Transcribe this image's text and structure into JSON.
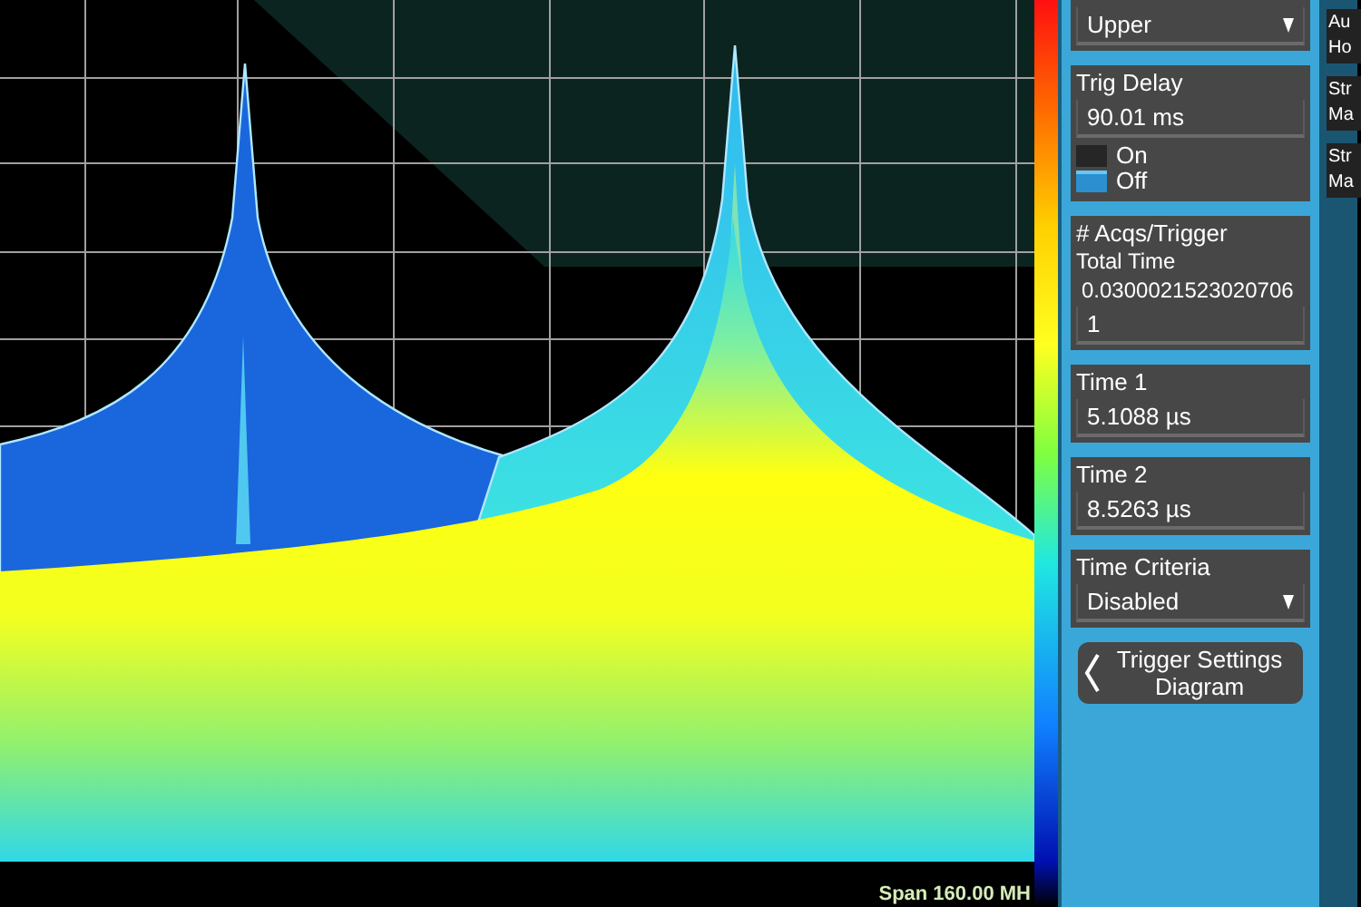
{
  "plot": {
    "span_label": "Span 160.00 MH"
  },
  "panel": {
    "groups": [
      {
        "items": [
          {
            "kind": "dropdown",
            "value": "Upper"
          }
        ]
      },
      {
        "label": "Trig Delay",
        "items": [
          {
            "kind": "field",
            "value": "90.01 ms"
          },
          {
            "kind": "toggle",
            "options": [
              {
                "label": "On",
                "selected": false
              },
              {
                "label": "Off",
                "selected": true
              }
            ]
          }
        ]
      },
      {
        "label": "# Acqs/Trigger",
        "items": [
          {
            "kind": "text",
            "text": "Total Time"
          },
          {
            "kind": "readout",
            "text": "0.0300021523020706"
          },
          {
            "kind": "field",
            "value": "1"
          }
        ]
      },
      {
        "label": "Time 1",
        "items": [
          {
            "kind": "field",
            "value": "5.1088 µs"
          }
        ]
      },
      {
        "label": "Time 2",
        "items": [
          {
            "kind": "field",
            "value": "8.5263 µs"
          }
        ]
      },
      {
        "label": "Time Criteria",
        "items": [
          {
            "kind": "dropdown",
            "value": "Disabled"
          }
        ]
      }
    ],
    "button": {
      "label": "Trigger Settings Diagram"
    }
  },
  "side_buttons": [
    {
      "label": "Au Ho"
    },
    {
      "label": "Str Ma"
    },
    {
      "label": "Str Ma"
    }
  ]
}
